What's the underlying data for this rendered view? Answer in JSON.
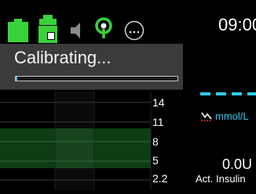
{
  "status_bar": {
    "icons": [
      "battery-icon",
      "reservoir-icon",
      "speaker-icon",
      "signal-icon",
      "menu-icon"
    ],
    "time": "09:00"
  },
  "calibration": {
    "title": "Calibrating...",
    "progress": 0.01
  },
  "graph": {
    "y_labels": [
      "14",
      "11",
      "8",
      "5",
      "2.2"
    ]
  },
  "sensor": {
    "unit": "mmol/L"
  },
  "insulin": {
    "value": "0.0U",
    "label": "Act. Insulin"
  },
  "colors": {
    "status_green": "#3ad23a",
    "accent_cyan": "#30c9ee",
    "graph_green": "#0e3d14",
    "panel_gray": "#3b3b3b"
  }
}
